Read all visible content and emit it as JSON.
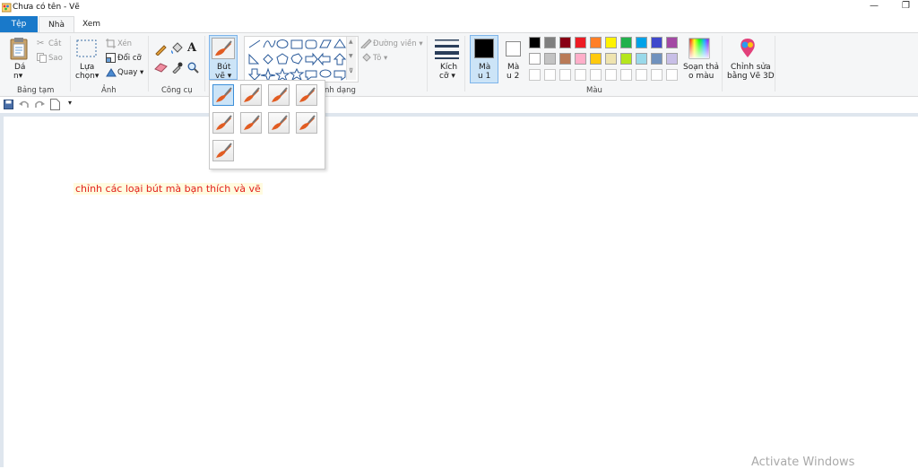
{
  "window": {
    "title": "Chưa có tên - Vẽ",
    "min_glyph": "—",
    "restore_glyph": "❐"
  },
  "tabs": [
    {
      "label": "Tệp"
    },
    {
      "label": "Nhà"
    },
    {
      "label": "Xem"
    }
  ],
  "clipboard": {
    "paste_l1": "Dá",
    "paste_l2": "n▾",
    "cut": "Cắt",
    "copy": "Sao",
    "group": "Bảng tạm"
  },
  "image": {
    "select_l1": "Lựa",
    "select_l2": "chọn▾",
    "crop": "Xén",
    "resize": "Đổi cỡ",
    "rotate": "Quay ▾",
    "group": "Ảnh"
  },
  "tools": {
    "group": "Công cụ",
    "text_glyph": "A"
  },
  "brushes": {
    "label_l1": "Bút",
    "label_l2": "vẽ ▾"
  },
  "shapes": {
    "outline": "Đường viền ▾",
    "fill": "Tô ▾",
    "group": "nh dạng"
  },
  "size": {
    "label_l1": "Kích",
    "label_l2": "cỡ ▾"
  },
  "colors": {
    "color1_l1": "Mà",
    "color1_l2": "u 1",
    "color2_l1": "Mà",
    "color2_l2": "u 2",
    "edit_l1": "Soạn thả",
    "edit_l2": "o màu",
    "group": "Màu",
    "color1_value": "#000000",
    "color2_value": "#ffffff",
    "palette_row1": [
      "#000000",
      "#7f7f7f",
      "#880015",
      "#ed1c24",
      "#ff7f27",
      "#fff200",
      "#22b14c",
      "#00a2e8",
      "#3f48cc",
      "#a349a4"
    ],
    "palette_row2": [
      "#ffffff",
      "#c3c3c3",
      "#b97a57",
      "#ffaec9",
      "#ffc90e",
      "#efe4b0",
      "#b5e61d",
      "#99d9ea",
      "#7092be",
      "#c8bfe7"
    ]
  },
  "paint3d": {
    "label_l1": "Chỉnh sửa",
    "label_l2": "bằng Vẽ 3D"
  },
  "canvas": {
    "note": "chỉnh các loại bút mà bạn thích và vẽ"
  },
  "watermark": "Activate Windows"
}
